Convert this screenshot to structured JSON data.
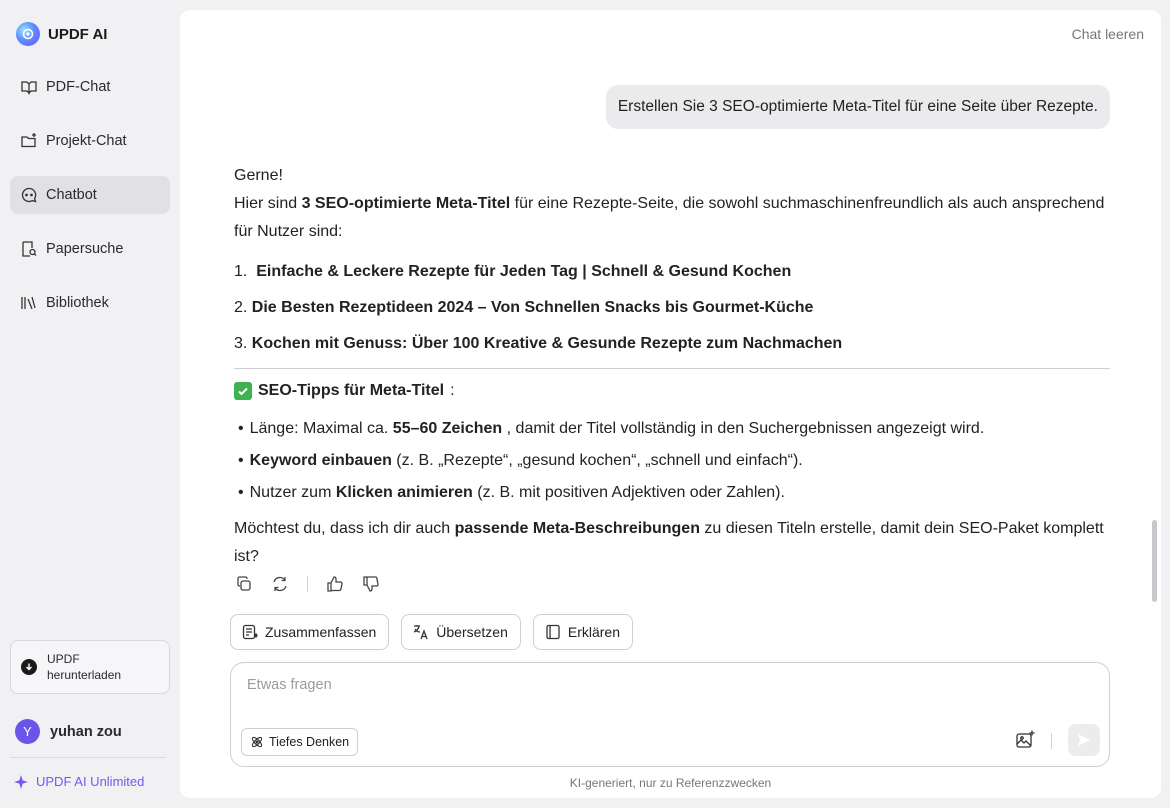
{
  "app": {
    "name": "UPDF AI"
  },
  "sidebar": {
    "items": [
      {
        "label": "PDF-Chat",
        "icon": "book-open-icon"
      },
      {
        "label": "Projekt-Chat",
        "icon": "folder-plus-icon"
      },
      {
        "label": "Chatbot",
        "icon": "chat-bubble-icon",
        "active": true
      },
      {
        "label": "Papersuche",
        "icon": "doc-search-icon"
      },
      {
        "label": "Bibliothek",
        "icon": "library-icon"
      }
    ],
    "download_label": "UPDF herunterladen",
    "user": {
      "initial": "Y",
      "name": "yuhan zou"
    },
    "unlimited_label": "UPDF AI Unlimited"
  },
  "header": {
    "clear_chat": "Chat leeren"
  },
  "conversation": {
    "user_message": "Erstellen Sie 3 SEO-optimierte Meta-Titel für eine Seite über Rezepte.",
    "answer": {
      "greeting": "Gerne!",
      "intro_prefix": "Hier sind ",
      "intro_bold": "3 SEO-optimierte Meta-Titel",
      "intro_suffix": " für eine Rezepte-Seite, die sowohl suchmaschinenfreundlich als auch ansprechend für Nutzer sind:",
      "titles": [
        {
          "num": "1.",
          "text": "Einfache & Leckere Rezepte für Jeden Tag | Schnell & Gesund Kochen"
        },
        {
          "num": "2.",
          "text": "Die Besten Rezeptideen 2024 – Von Schnellen Snacks bis Gourmet-Küche"
        },
        {
          "num": "3.",
          "text": "Kochen mit Genuss: Über 100 Kreative & Gesunde Rezepte zum Nachmachen"
        }
      ],
      "tips_title": "SEO-Tipps für Meta-Titel",
      "tips_colon": " :",
      "tips": [
        {
          "pre": "Länge: Maximal ca. ",
          "bold": "55–60 Zeichen",
          "post": " , damit der Titel vollständig in den Suchergebnissen angezeigt wird."
        },
        {
          "pre": "",
          "bold": "Keyword einbauen",
          "post": " (z. B. „Rezepte“, „gesund kochen“, „schnell und einfach“)."
        },
        {
          "pre": "Nutzer zum ",
          "bold": "Klicken animieren",
          "post": " (z. B. mit positiven Adjektiven oder Zahlen)."
        }
      ],
      "closing_prefix": "Möchtest du, dass ich dir auch ",
      "closing_bold": "passende Meta-Beschreibungen",
      "closing_suffix": " zu diesen Titeln erstelle, damit dein SEO-Paket komplett ist?"
    }
  },
  "quick_actions": [
    {
      "label": "Zusammenfassen",
      "icon": "summarize-icon"
    },
    {
      "label": "Übersetzen",
      "icon": "translate-icon"
    },
    {
      "label": "Erklären",
      "icon": "book-icon"
    }
  ],
  "composer": {
    "placeholder": "Etwas fragen",
    "deep_think_label": "Tiefes Denken"
  },
  "footer_note": "KI-generiert, nur zu Referenzzwecken",
  "colors": {
    "accent": "#7a55f0",
    "avatar": "#6a55e8",
    "active_nav": "#e1e1e5"
  }
}
